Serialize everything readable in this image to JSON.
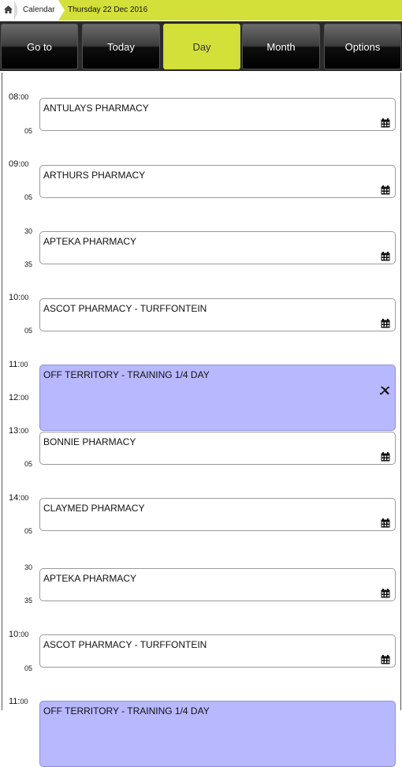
{
  "breadcrumb": {
    "calendar_label": "Calendar",
    "date_label": "Thursday 22 Dec 2016"
  },
  "toolbar": {
    "goto": "Go to",
    "today": "Today",
    "day": "Day",
    "month": "Month",
    "options": "Options"
  },
  "times": [
    {
      "h": "08:",
      "m": "00"
    },
    {
      "h": "09:",
      "m": "00"
    },
    {
      "h": "10:",
      "m": "00"
    },
    {
      "h": "11:",
      "m": "00"
    },
    {
      "h": "12:",
      "m": "00"
    },
    {
      "h": "13:",
      "m": "00"
    },
    {
      "h": "14:",
      "m": "00"
    },
    {
      "h": "10:",
      "m": "00"
    },
    {
      "h": "11:",
      "m": "00"
    }
  ],
  "minutes": [
    "05",
    "05",
    "30",
    "35",
    "05",
    "05",
    "05",
    "30",
    "35",
    "05"
  ],
  "appointments": [
    {
      "name": "ANTULAYS PHARMACY",
      "icon": "calendar-icon"
    },
    {
      "name": "ARTHURS PHARMACY",
      "icon": "calendar-icon"
    },
    {
      "name": "APTEKA PHARMACY",
      "icon": "calendar-icon"
    },
    {
      "name": "ASCOT PHARMACY - TURFFONTEIN",
      "icon": "calendar-icon"
    },
    {
      "name": "OFF TERRITORY - TRAINING 1/4 DAY",
      "icon": "airplane-icon"
    },
    {
      "name": "BONNIE PHARMACY",
      "icon": "calendar-icon"
    },
    {
      "name": "CLAYMED PHARMACY",
      "icon": "calendar-icon"
    },
    {
      "name": "APTEKA PHARMACY",
      "icon": "calendar-icon"
    },
    {
      "name": "ASCOT PHARMACY - TURFFONTEIN",
      "icon": "calendar-icon"
    },
    {
      "name": "OFF TERRITORY - TRAINING 1/4 DAY",
      "icon": "airplane-icon"
    }
  ],
  "colors": {
    "accent": "#d4e03a",
    "busy": "#b8b8ff"
  }
}
